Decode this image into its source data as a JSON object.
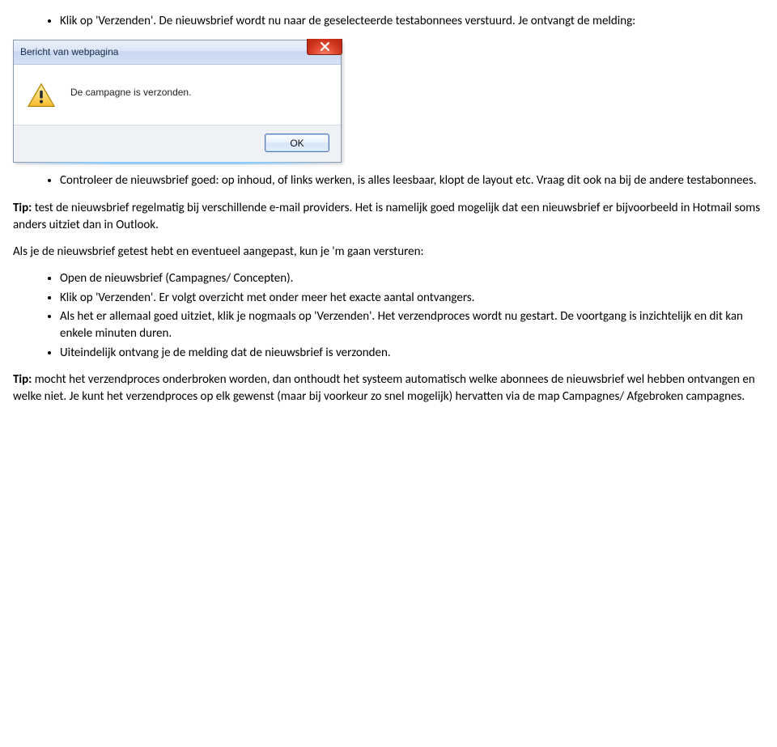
{
  "intro": {
    "bullet1": "Klik op 'Verzenden'. De nieuwsbrief wordt nu naar de geselecteerde testabonnees verstuurd. Je ontvangt de melding:"
  },
  "dialog": {
    "title": "Bericht van webpagina",
    "message": "De campagne is verzonden.",
    "ok_label": "OK"
  },
  "after_dialog": {
    "bullet1": "Controleer de nieuwsbrief goed: op inhoud, of links werken, is alles leesbaar, klopt de layout etc. Vraag dit ook na bij de andere testabonnees."
  },
  "tip1": {
    "label": "Tip:",
    "text": " test de nieuwsbrief regelmatig bij verschillende e-mail providers. Het is namelijk goed mogelijk dat een nieuwsbrief er bijvoorbeeld in Hotmail soms anders uitziet dan in Outlook."
  },
  "paragraph_send": "Als je de nieuwsbrief getest hebt en eventueel aangepast, kun je 'm gaan versturen:",
  "send_steps": {
    "b1": "Open de nieuwsbrief (Campagnes/ Concepten).",
    "b2": "Klik op 'Verzenden'. Er volgt overzicht met onder meer het exacte aantal ontvangers.",
    "b3": "Als het er allemaal goed uitziet, klik je nogmaals op 'Verzenden'. Het verzendproces wordt nu gestart. De voortgang is inzichtelijk en dit kan enkele minuten duren.",
    "b4": "Uiteindelijk ontvang je de melding dat de nieuwsbrief is verzonden."
  },
  "tip2": {
    "label": "Tip:",
    "text": " mocht het verzendproces onderbroken worden, dan onthoudt het systeem automatisch welke abonnees de nieuwsbrief wel hebben ontvangen en welke niet. Je kunt het verzendproces op elk gewenst (maar bij voorkeur zo snel mogelijk) hervatten via de map Campagnes/ Afgebroken campagnes."
  }
}
